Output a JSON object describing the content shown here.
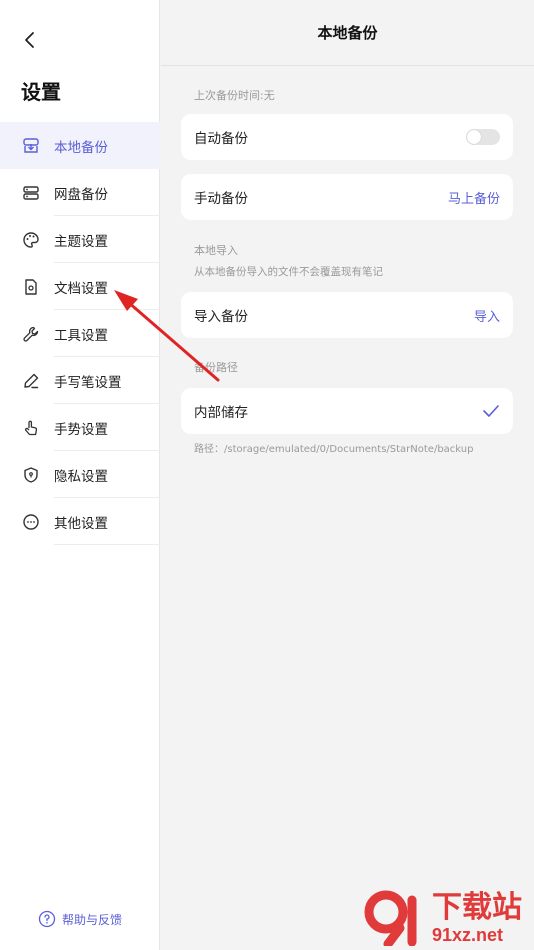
{
  "sidebar": {
    "title": "设置",
    "items": [
      {
        "label": "本地备份",
        "icon": "local-backup-icon",
        "active": true
      },
      {
        "label": "网盘备份",
        "icon": "cloud-drive-icon",
        "active": false
      },
      {
        "label": "主题设置",
        "icon": "palette-icon",
        "active": false
      },
      {
        "label": "文档设置",
        "icon": "document-gear-icon",
        "active": false
      },
      {
        "label": "工具设置",
        "icon": "wrench-icon",
        "active": false
      },
      {
        "label": "手写笔设置",
        "icon": "pen-icon",
        "active": false
      },
      {
        "label": "手势设置",
        "icon": "hand-gesture-icon",
        "active": false
      },
      {
        "label": "隐私设置",
        "icon": "shield-icon",
        "active": false
      },
      {
        "label": "其他设置",
        "icon": "more-dots-icon",
        "active": false
      }
    ],
    "help_label": "帮助与反馈"
  },
  "header": {
    "title": "本地备份"
  },
  "main": {
    "last_backup": "上次备份时间:无",
    "auto_backup": {
      "label": "自动备份",
      "enabled": false
    },
    "manual_backup": {
      "label": "手动备份",
      "action": "马上备份"
    },
    "import_section": {
      "title": "本地导入",
      "note": "从本地备份导入的文件不会覆盖现有笔记"
    },
    "import_backup": {
      "label": "导入备份",
      "action": "导入"
    },
    "path_section": {
      "title": "备份路径"
    },
    "internal_storage": {
      "label": "内部储存",
      "selected": true
    },
    "path_text": "路径：/storage/emulated/0/Documents/StarNote/backup"
  },
  "watermark": {
    "brand": "下载站",
    "site": "91xz.net"
  },
  "colors": {
    "accent": "#5b5fd6",
    "arrow": "#e02424",
    "watermark": "#e03a3a"
  }
}
